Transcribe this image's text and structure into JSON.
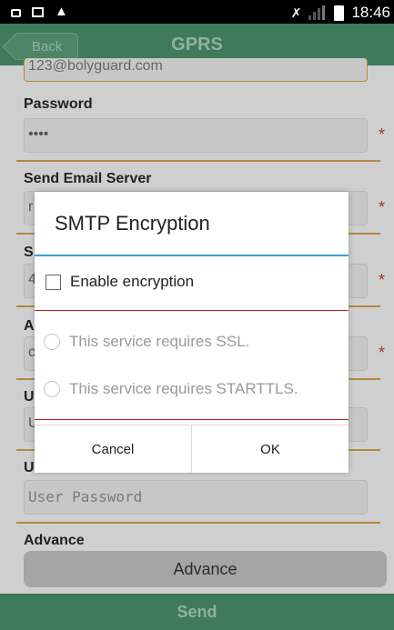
{
  "status_bar": {
    "time": "18:46",
    "left_icons": [
      "lock-icon",
      "image-icon",
      "warning-icon"
    ],
    "right_icons": [
      "mute-icon",
      "signal-icon",
      "battery-icon"
    ]
  },
  "header": {
    "back_label": "Back",
    "title": "GPRS"
  },
  "form": {
    "email_value": "123@bolyguard.com",
    "password_label": "Password",
    "password_value": "••••",
    "send_email_server_label": "Send Email Server",
    "user_password_placeholder": "User Password",
    "advance_label": "Advance",
    "advance_button": "Advance",
    "required_mark": "*",
    "send_button": "Send",
    "partial_letters": {
      "server_field_initial": "r",
      "port_label_initial": "S",
      "port_field_initial": "4",
      "account_label_initial": "A",
      "account_field_initial": "c",
      "user_label_initial": "U",
      "user_field_initial": "U",
      "user_password_label_initial": "U"
    }
  },
  "dialog": {
    "title": "SMTP Encryption",
    "enable_label": "Enable encryption",
    "ssl_label": "This service requires SSL.",
    "starttls_label": "This service requires STARTTLS.",
    "cancel_label": "Cancel",
    "ok_label": "OK"
  },
  "colors": {
    "header_bg": "#3f7a5a",
    "accent_line": "#3aa0d4",
    "divider": "#b48a3e",
    "required": "#aa3333"
  }
}
